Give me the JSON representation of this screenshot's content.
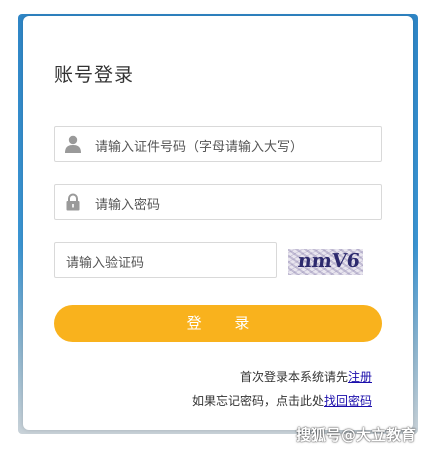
{
  "login": {
    "title": "账号登录",
    "id_placeholder": "请输入证件号码（字母请输入大写）",
    "password_placeholder": "请输入密码",
    "captcha_placeholder": "请输入验证码",
    "captcha_text": "nmV6",
    "submit_label": "登 录"
  },
  "footer": {
    "register_prefix": "首次登录本系统请先",
    "register_link": "注册",
    "recover_prefix": "如果忘记密码，点击此处",
    "recover_link": "找回密码"
  },
  "watermark": "搜狐号@大立教育",
  "icons": {
    "user": "user-icon",
    "lock": "lock-icon"
  },
  "colors": {
    "accent": "#f9b21d",
    "background_blue": "#2f86c6",
    "link": "#1a0dab"
  }
}
